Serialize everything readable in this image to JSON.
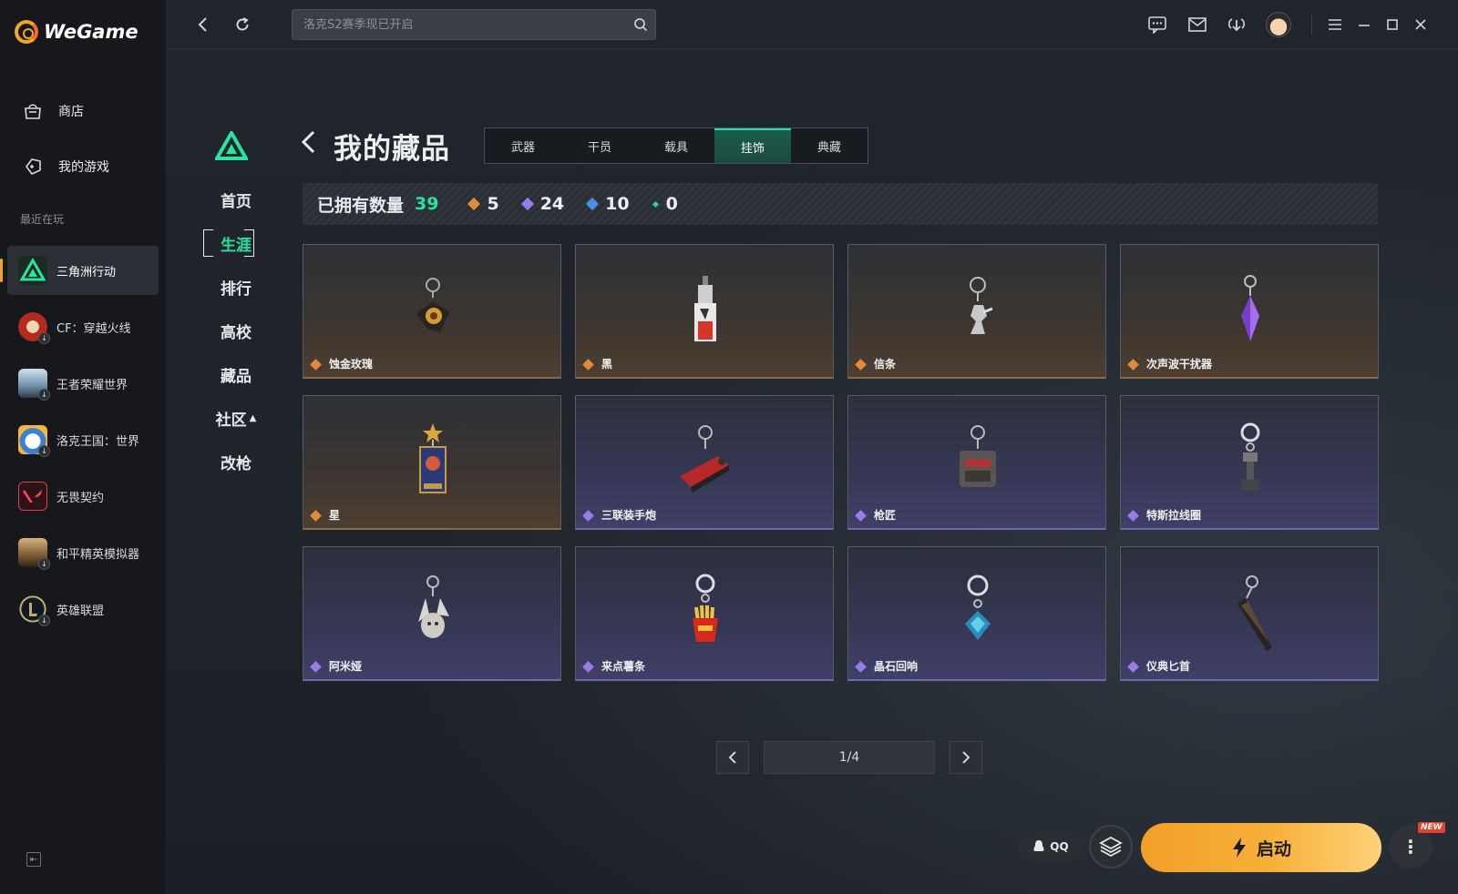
{
  "app": {
    "logo_text": "WeGame"
  },
  "sidebar": {
    "store_label": "商店",
    "mygames_label": "我的游戏",
    "recent_label": "最近在玩",
    "games": [
      {
        "name": "三角洲行动",
        "active": true
      },
      {
        "name": "CF：穿越火线"
      },
      {
        "name": "王者荣耀世界"
      },
      {
        "name": "洛克王国：世界"
      },
      {
        "name": "无畏契约"
      },
      {
        "name": "和平精英模拟器"
      },
      {
        "name": "英雄联盟"
      }
    ]
  },
  "topbar": {
    "search_placeholder": "洛克S2赛季现已开启",
    "icons": [
      "back-icon",
      "refresh-icon",
      "search-icon",
      "chat-icon",
      "mail-icon",
      "download-icon",
      "avatar",
      "menu-icon",
      "minimize-icon",
      "maximize-icon",
      "close-icon"
    ]
  },
  "subnav": {
    "items": [
      "首页",
      "生涯",
      "排行",
      "高校",
      "藏品",
      "社区",
      "改枪"
    ],
    "active": "生涯"
  },
  "collection": {
    "title": "我的藏品",
    "tabs": [
      "武器",
      "干员",
      "载具",
      "挂饰",
      "典藏"
    ],
    "active_tab": "挂饰",
    "stats": {
      "label": "已拥有数量",
      "total": "39",
      "counts": [
        {
          "value": "5",
          "color": "#e08a3c"
        },
        {
          "value": "24",
          "color": "#9a7ce8"
        },
        {
          "value": "10",
          "color": "#4a8ee8"
        },
        {
          "value": "0",
          "color": "#2fd0a0"
        }
      ]
    },
    "items": [
      {
        "name": "蚀金玫瑰",
        "rarity": "gold"
      },
      {
        "name": "黑",
        "rarity": "gold"
      },
      {
        "name": "信条",
        "rarity": "gold"
      },
      {
        "name": "次声波干扰器",
        "rarity": "gold"
      },
      {
        "name": "星",
        "rarity": "gold"
      },
      {
        "name": "三联装手炮",
        "rarity": "purple"
      },
      {
        "name": "枪匠",
        "rarity": "purple"
      },
      {
        "name": "特斯拉线圈",
        "rarity": "purple"
      },
      {
        "name": "阿米娅",
        "rarity": "purple"
      },
      {
        "name": "来点薯条",
        "rarity": "purple"
      },
      {
        "name": "晶石回响",
        "rarity": "purple"
      },
      {
        "name": "仪典匕首",
        "rarity": "purple"
      }
    ],
    "page": "1/4"
  },
  "launch": {
    "qq_label": "QQ",
    "launch_label": "启动",
    "new_badge": "NEW"
  },
  "colors": {
    "accent_green": "#27e5a0",
    "launch_orange": "#f5a524",
    "rarity_gold": "#e08a3c",
    "rarity_purple": "#9a7ce8"
  }
}
